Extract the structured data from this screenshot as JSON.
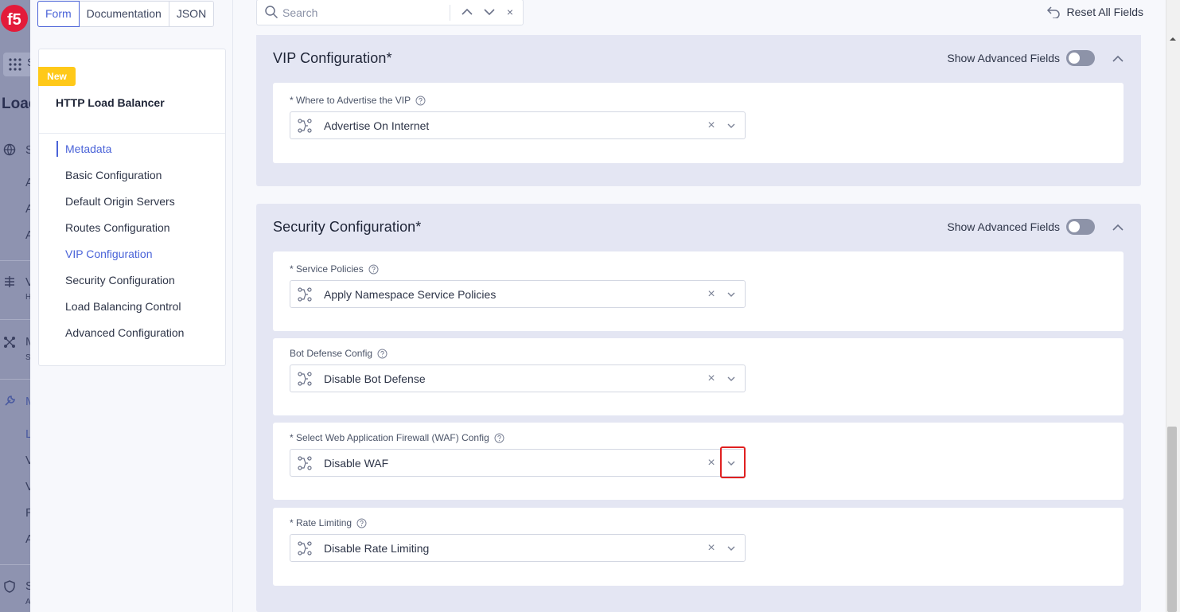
{
  "appnav": {
    "search_stub": "S",
    "page_title_stub": "Loac",
    "items": [
      {
        "letter": "S",
        "sub": ""
      },
      {
        "letter": "A",
        "sub": ""
      },
      {
        "letter": "A",
        "sub": ""
      },
      {
        "letter": "A",
        "sub": ""
      },
      {
        "letter": "V",
        "sub": "H"
      },
      {
        "letter": "M",
        "sub": "S"
      },
      {
        "letter": "M",
        "sub": ""
      },
      {
        "letter": "L",
        "sub": ""
      },
      {
        "letter": "V",
        "sub": ""
      },
      {
        "letter": "V",
        "sub": ""
      },
      {
        "letter": "R",
        "sub": ""
      },
      {
        "letter": "A",
        "sub": ""
      },
      {
        "letter": "S",
        "sub": "A"
      }
    ]
  },
  "view_tabs": [
    "Form",
    "Documentation",
    "JSON"
  ],
  "active_tab": "Form",
  "sidebar": {
    "badge": "New",
    "title": "HTTP Load Balancer",
    "items": [
      {
        "label": "Metadata"
      },
      {
        "label": "Basic Configuration"
      },
      {
        "label": "Default Origin Servers"
      },
      {
        "label": "Routes Configuration"
      },
      {
        "label": "VIP Configuration"
      },
      {
        "label": "Security Configuration"
      },
      {
        "label": "Load Balancing Control"
      },
      {
        "label": "Advanced Configuration"
      }
    ]
  },
  "search": {
    "placeholder": "Search",
    "up": "⌃",
    "down": "⌄",
    "clear": "×"
  },
  "reset_label": "Reset All Fields",
  "sections": {
    "vip": {
      "title": "VIP Configuration",
      "required": "*",
      "advanced_label": "Show Advanced Fields",
      "fields": {
        "advertise": {
          "label": "* Where to Advertise the VIP",
          "value": "Advertise On Internet"
        }
      }
    },
    "security": {
      "title": "Security Configuration",
      "required": "*",
      "advanced_label": "Show Advanced Fields",
      "fields": {
        "service_policies": {
          "label": "* Service Policies",
          "value": "Apply Namespace Service Policies"
        },
        "bot_defense": {
          "label": "Bot Defense Config",
          "value": "Disable Bot Defense"
        },
        "waf": {
          "label": "* Select Web Application Firewall (WAF) Config",
          "value": "Disable WAF"
        },
        "rate_limiting": {
          "label": "* Rate Limiting",
          "value": "Disable Rate Limiting"
        }
      }
    }
  },
  "clear_glyph": "×",
  "colors": {
    "accent": "#4a63d8",
    "badge": "#ffc919",
    "section_bg": "#e4e6f3",
    "highlight": "#e02020"
  }
}
